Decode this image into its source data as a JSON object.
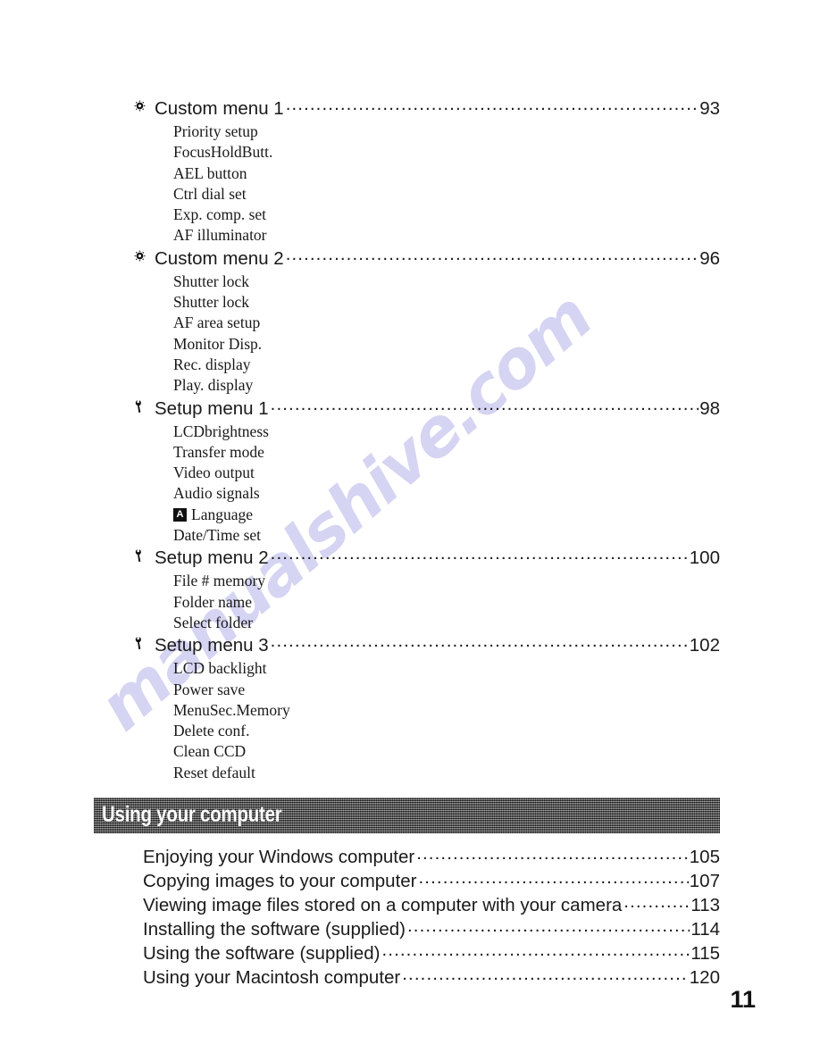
{
  "watermark": {
    "text": "manualshive.com",
    "color": "#d3d2f2"
  },
  "toc": {
    "groups": [
      {
        "icon": "gear-icon",
        "label": "Custom menu 1",
        "page": "93",
        "items": [
          "Priority setup",
          "FocusHoldButt.",
          "AEL button",
          "Ctrl dial set",
          "Exp. comp. set",
          "AF illuminator"
        ]
      },
      {
        "icon": "gear-icon",
        "label": "Custom menu 2",
        "page": "96",
        "items": [
          "Shutter lock",
          "Shutter lock",
          "AF area setup",
          "Monitor Disp.",
          "Rec. display",
          "Play. display"
        ]
      },
      {
        "icon": "wrench-icon",
        "label": "Setup menu 1",
        "page": "98",
        "items": [
          "LCDbrightness",
          "Transfer mode",
          "Video output",
          "Audio signals",
          "Language",
          "Date/Time set"
        ],
        "badge_item_index": 4,
        "badge_text": "A"
      },
      {
        "icon": "wrench-icon",
        "label": "Setup menu 2",
        "page": "100",
        "items": [
          "File # memory",
          "Folder name",
          "Select folder"
        ]
      },
      {
        "icon": "wrench-icon",
        "label": "Setup menu 3",
        "page": "102",
        "items": [
          "LCD backlight",
          "Power save",
          "MenuSec.Memory",
          "Delete conf.",
          "Clean CCD",
          "Reset default"
        ]
      }
    ]
  },
  "section": {
    "banner_title": "Using your computer",
    "entries": [
      {
        "label": "Enjoying your Windows computer",
        "page": "105"
      },
      {
        "label": "Copying images to your computer",
        "page": "107"
      },
      {
        "label": "Viewing image files stored on a computer with your camera",
        "page": "113"
      },
      {
        "label": "Installing the software (supplied)",
        "page": "114"
      },
      {
        "label": "Using the software (supplied)",
        "page": "115"
      },
      {
        "label": "Using your Macintosh computer",
        "page": "120"
      }
    ]
  },
  "folio": {
    "page_number": "11"
  }
}
